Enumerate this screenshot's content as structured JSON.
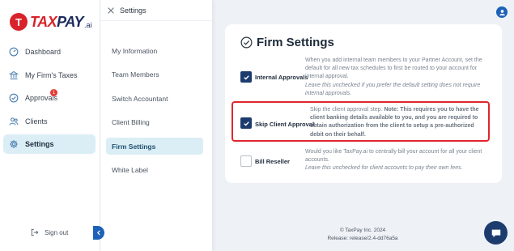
{
  "brand": {
    "logo_mark": "T",
    "name_tax": "TAX",
    "name_pay": "PAY",
    "name_suffix": ".ai"
  },
  "nav": {
    "items": [
      {
        "label": "Dashboard",
        "icon": "dashboard-gauge-icon"
      },
      {
        "label": "My Firm's Taxes",
        "icon": "bank-icon"
      },
      {
        "label": "Approvals",
        "icon": "check-circle-icon",
        "badge": "1"
      },
      {
        "label": "Clients",
        "icon": "people-icon"
      },
      {
        "label": "Settings",
        "icon": "gear-icon",
        "active": true
      }
    ],
    "sign_out": "Sign out"
  },
  "settings_panel": {
    "title": "Settings",
    "items": [
      {
        "label": "My Information"
      },
      {
        "label": "Team Members"
      },
      {
        "label": "Switch Accountant"
      },
      {
        "label": "Client Billing"
      },
      {
        "label": "Firm Settings",
        "active": true
      },
      {
        "label": "White Label"
      }
    ]
  },
  "firm_settings": {
    "title": "Firm Settings",
    "options": [
      {
        "label": "Internal Approvals",
        "checked": true,
        "desc": "When you add internal team members to your Partner Account, set the default for all new tax schedules to first be routed to your account for internal approval.",
        "hint": "Leave this unchecked if you prefer the default setting does not require internal approvals."
      },
      {
        "label": "Skip Client Approval",
        "checked": true,
        "desc": "Skip the client approval step.",
        "note": "Note: This requires you to have the client banking details available to you, and you are required to obtain authorization from the client to setup a pre-authorized debit on their behalf."
      },
      {
        "label": "Bill Reseller",
        "checked": false,
        "desc": "Would you like TaxPay.ai to centrally bill your account for all your client accounts.",
        "hint": "Leave this unchecked for client accounts to pay their own fees."
      }
    ]
  },
  "footer": {
    "copyright": "© TaxPay Inc. 2024",
    "release": "Release: release/2.4-dd76a5a"
  },
  "colors": {
    "accent": "#1d62b8",
    "brand_red": "#d8232a",
    "highlight": "#e0262d",
    "active_bg": "#dbeef6"
  }
}
